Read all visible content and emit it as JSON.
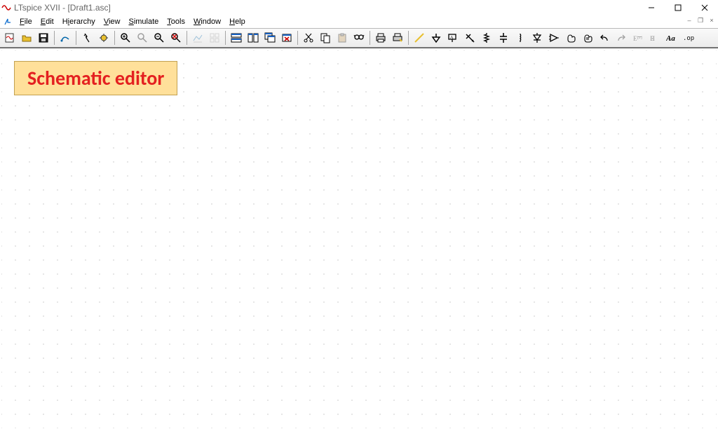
{
  "window": {
    "title": "LTspice XVII - [Draft1.asc]"
  },
  "menus": {
    "file": "File",
    "edit": "Edit",
    "hierarchy": "Hierarchy",
    "view": "View",
    "simulate": "Simulate",
    "tools": "Tools",
    "window": "Window",
    "help": "Help"
  },
  "overlay": {
    "label": "Schematic editor"
  },
  "icons": {
    "new": "new-schematic",
    "open": "open",
    "save": "save",
    "setup": "sim-setup",
    "run": "run",
    "halt": "halt",
    "zoomin": "zoom-in",
    "pan": "pan",
    "zoomout": "zoom-out",
    "zoomfit": "zoom-fit",
    "pick": "pick-data",
    "step": "auto-step",
    "tile1": "tile-horizontal",
    "tile2": "tile-vertical",
    "cascade": "cascade",
    "close": "close-window",
    "cut": "cut",
    "copy": "copy",
    "paste": "paste",
    "find": "find",
    "print": "print",
    "printsetup": "print-setup",
    "wire": "wire",
    "ground": "ground",
    "label": "net-label",
    "netflag": "net-flag",
    "resistor": "resistor",
    "capacitor": "capacitor",
    "inductor": "inductor",
    "diode": "diode",
    "component": "component",
    "move": "move",
    "drag": "drag",
    "undo": "undo",
    "redo": "redo",
    "rotate": "rotate",
    "mirror": "mirror",
    "text": "text",
    "spice": "spice-directive"
  }
}
